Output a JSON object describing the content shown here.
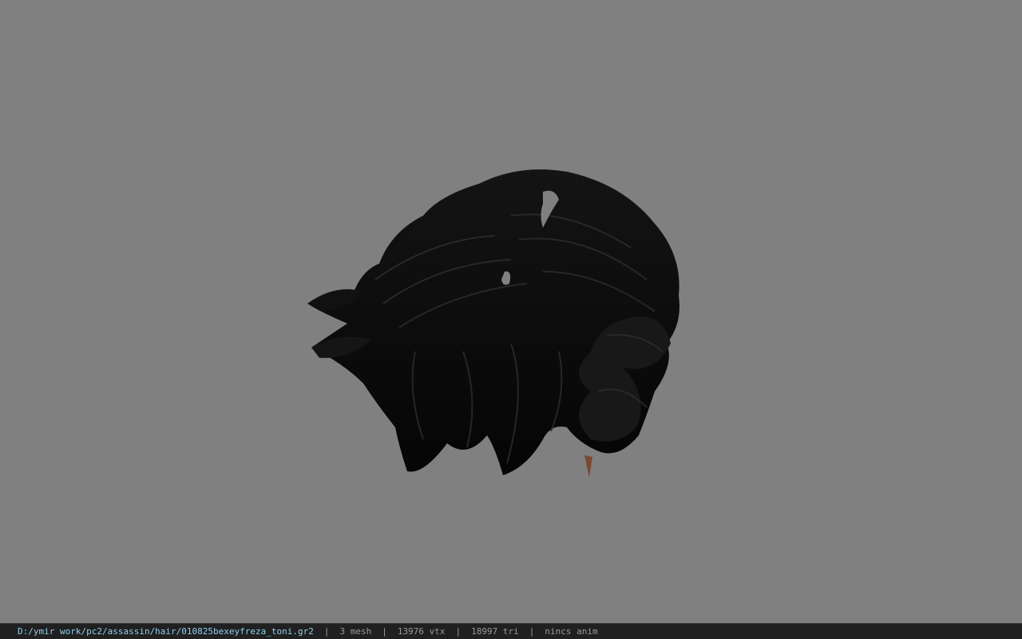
{
  "viewport": {
    "background": "#808080",
    "model": {
      "subject": "hair-mesh",
      "hair_color": "#0b0b0b",
      "skin_color": "#7a4a30"
    }
  },
  "statusbar": {
    "path": "D:/ymir work/pc2/assassin/hair/010825bexeyfreza_toni.gr2",
    "separator": "|",
    "mesh": "3 mesh",
    "vtx": "13976 vtx",
    "tri": "18997 tri",
    "anim": "nincs anim",
    "path_color": "#8fd0f0",
    "text_color": "#9a9a9a"
  }
}
